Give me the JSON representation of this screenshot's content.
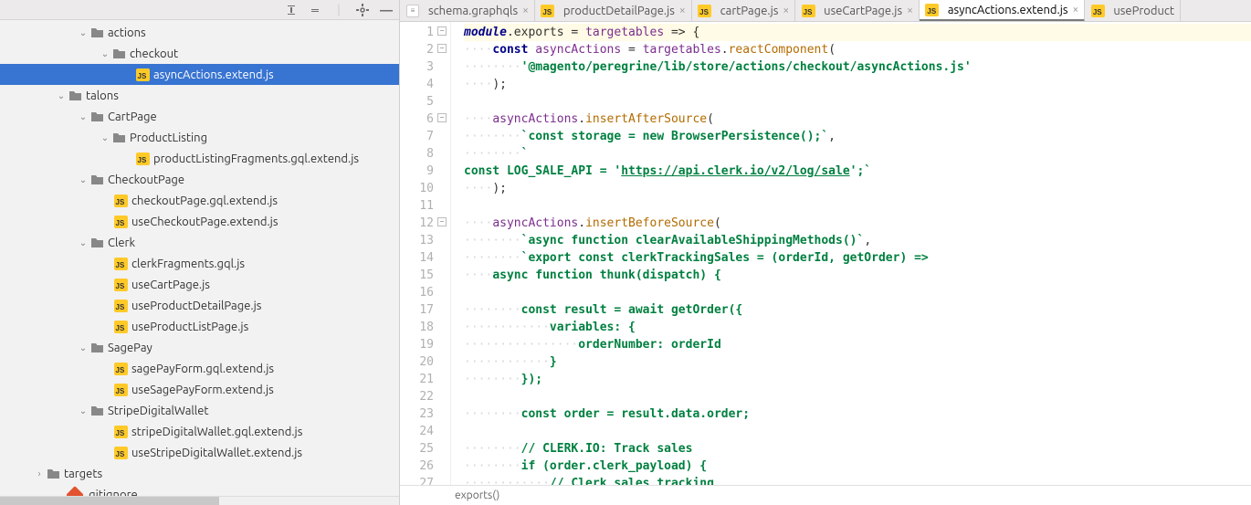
{
  "sidebar": {
    "tree": [
      {
        "indent": 84,
        "expander": "v",
        "icon": "folder",
        "label": "actions"
      },
      {
        "indent": 108,
        "expander": "v",
        "icon": "folder",
        "label": "checkout"
      },
      {
        "indent": 134,
        "expander": "",
        "icon": "js",
        "label": "asyncActions.extend.js",
        "selected": true
      },
      {
        "indent": 60,
        "expander": "v",
        "icon": "folder",
        "label": "talons"
      },
      {
        "indent": 84,
        "expander": "v",
        "icon": "folder",
        "label": "CartPage"
      },
      {
        "indent": 108,
        "expander": "v",
        "icon": "folder",
        "label": "ProductListing"
      },
      {
        "indent": 134,
        "expander": "",
        "icon": "js",
        "label": "productListingFragments.gql.extend.js"
      },
      {
        "indent": 84,
        "expander": "v",
        "icon": "folder",
        "label": "CheckoutPage"
      },
      {
        "indent": 110,
        "expander": "",
        "icon": "js",
        "label": "checkoutPage.gql.extend.js"
      },
      {
        "indent": 110,
        "expander": "",
        "icon": "js",
        "label": "useCheckoutPage.extend.js"
      },
      {
        "indent": 84,
        "expander": "v",
        "icon": "folder",
        "label": "Clerk"
      },
      {
        "indent": 110,
        "expander": "",
        "icon": "js",
        "label": "clerkFragments.gql.js"
      },
      {
        "indent": 110,
        "expander": "",
        "icon": "js",
        "label": "useCartPage.js"
      },
      {
        "indent": 110,
        "expander": "",
        "icon": "js",
        "label": "useProductDetailPage.js"
      },
      {
        "indent": 110,
        "expander": "",
        "icon": "js",
        "label": "useProductListPage.js"
      },
      {
        "indent": 84,
        "expander": "v",
        "icon": "folder",
        "label": "SagePay"
      },
      {
        "indent": 110,
        "expander": "",
        "icon": "js",
        "label": "sagePayForm.gql.extend.js"
      },
      {
        "indent": 110,
        "expander": "",
        "icon": "js",
        "label": "useSagePayForm.extend.js"
      },
      {
        "indent": 84,
        "expander": "v",
        "icon": "folder",
        "label": "StripeDigitalWallet"
      },
      {
        "indent": 110,
        "expander": "",
        "icon": "js",
        "label": "stripeDigitalWallet.gql.extend.js"
      },
      {
        "indent": 110,
        "expander": "",
        "icon": "js",
        "label": "useStripeDigitalWallet.extend.js"
      },
      {
        "indent": 36,
        "expander": ">",
        "icon": "folder",
        "label": "targets"
      },
      {
        "indent": 60,
        "expander": "",
        "icon": "git",
        "label": ".gitignore"
      }
    ]
  },
  "tabs": [
    {
      "icon": "gql",
      "label": "schema.graphqls"
    },
    {
      "icon": "js",
      "label": "productDetailPage.js"
    },
    {
      "icon": "js",
      "label": "cartPage.js"
    },
    {
      "icon": "js",
      "label": "useCartPage.js"
    },
    {
      "icon": "js",
      "label": "asyncActions.extend.js",
      "active": true
    },
    {
      "icon": "js",
      "label": "useProduct"
    }
  ],
  "code": {
    "lines": [
      {
        "n": 1,
        "fold": "-",
        "hl": true,
        "tokens": [
          {
            "t": "module",
            "c": "kw2"
          },
          {
            "t": ".exports = "
          },
          {
            "t": "targetables",
            "c": "def"
          },
          {
            "t": " => {"
          }
        ]
      },
      {
        "n": 2,
        "fold": "-",
        "tokens": [
          {
            "t": "    ",
            "d": 1
          },
          {
            "t": "const ",
            "c": "kw"
          },
          {
            "t": "asyncActions",
            "c": "def"
          },
          {
            "t": " = "
          },
          {
            "t": "targetables",
            "c": "def"
          },
          {
            "t": "."
          },
          {
            "t": "reactComponent",
            "c": "fn"
          },
          {
            "t": "("
          }
        ]
      },
      {
        "n": 3,
        "tokens": [
          {
            "t": "        ",
            "d": 1
          },
          {
            "t": "'@magento/peregrine/lib/store/actions/checkout/asyncActions.js'",
            "c": "str"
          }
        ]
      },
      {
        "n": 4,
        "tokens": [
          {
            "t": "    ",
            "d": 1
          },
          {
            "t": ");"
          }
        ]
      },
      {
        "n": 5,
        "tokens": [
          {
            "t": ""
          }
        ]
      },
      {
        "n": 6,
        "fold": "-",
        "tokens": [
          {
            "t": "    ",
            "d": 1
          },
          {
            "t": "asyncActions",
            "c": "def"
          },
          {
            "t": "."
          },
          {
            "t": "insertAfterSource",
            "c": "fn"
          },
          {
            "t": "("
          }
        ]
      },
      {
        "n": 7,
        "tokens": [
          {
            "t": "        ",
            "d": 1
          },
          {
            "t": "`const storage = new BrowserPersistence();`",
            "c": "str"
          },
          {
            "t": ","
          }
        ]
      },
      {
        "n": 8,
        "tokens": [
          {
            "t": "        ",
            "d": 1
          },
          {
            "t": "`",
            "c": "str"
          }
        ]
      },
      {
        "n": 9,
        "tokens": [
          {
            "t": "const LOG_SALE_API = '",
            "c": "str"
          },
          {
            "t": "https://api.clerk.io/v2/log/sale",
            "c": "str url"
          },
          {
            "t": "';`",
            "c": "str"
          }
        ]
      },
      {
        "n": 10,
        "tokens": [
          {
            "t": "    ",
            "d": 1
          },
          {
            "t": ");"
          }
        ]
      },
      {
        "n": 11,
        "tokens": [
          {
            "t": ""
          }
        ]
      },
      {
        "n": 12,
        "fold": "-",
        "tokens": [
          {
            "t": "    ",
            "d": 1
          },
          {
            "t": "asyncActions",
            "c": "def"
          },
          {
            "t": "."
          },
          {
            "t": "insertBeforeSource",
            "c": "fn"
          },
          {
            "t": "("
          }
        ]
      },
      {
        "n": 13,
        "tokens": [
          {
            "t": "        ",
            "d": 1
          },
          {
            "t": "`async function clearAvailableShippingMethods()`",
            "c": "str"
          },
          {
            "t": ","
          }
        ]
      },
      {
        "n": 14,
        "tokens": [
          {
            "t": "        ",
            "d": 1
          },
          {
            "t": "`export const clerkTrackingSales = (orderId, getOrder) =>",
            "c": "str"
          }
        ]
      },
      {
        "n": 15,
        "tokens": [
          {
            "t": "    ",
            "d": 1
          },
          {
            "t": "async function thunk(dispatch) {",
            "c": "str"
          }
        ]
      },
      {
        "n": 16,
        "tokens": [
          {
            "t": ""
          }
        ]
      },
      {
        "n": 17,
        "tokens": [
          {
            "t": "        ",
            "d": 1
          },
          {
            "t": "const result = await getOrder({",
            "c": "str"
          }
        ]
      },
      {
        "n": 18,
        "tokens": [
          {
            "t": "            ",
            "d": 1
          },
          {
            "t": "variables: {",
            "c": "str"
          }
        ]
      },
      {
        "n": 19,
        "tokens": [
          {
            "t": "                ",
            "d": 1
          },
          {
            "t": "orderNumber: orderId",
            "c": "str"
          }
        ]
      },
      {
        "n": 20,
        "tokens": [
          {
            "t": "            ",
            "d": 1
          },
          {
            "t": "}",
            "c": "str"
          }
        ]
      },
      {
        "n": 21,
        "tokens": [
          {
            "t": "        ",
            "d": 1
          },
          {
            "t": "});",
            "c": "str"
          }
        ]
      },
      {
        "n": 22,
        "tokens": [
          {
            "t": ""
          }
        ]
      },
      {
        "n": 23,
        "tokens": [
          {
            "t": "        ",
            "d": 1
          },
          {
            "t": "const order = result.data.order;",
            "c": "str"
          }
        ]
      },
      {
        "n": 24,
        "tokens": [
          {
            "t": ""
          }
        ]
      },
      {
        "n": 25,
        "tokens": [
          {
            "t": "        ",
            "d": 1
          },
          {
            "t": "// CLERK.IO: Track sales",
            "c": "str"
          }
        ]
      },
      {
        "n": 26,
        "tokens": [
          {
            "t": "        ",
            "d": 1
          },
          {
            "t": "if (order.clerk_payload) {",
            "c": "str"
          }
        ]
      },
      {
        "n": 27,
        "tokens": [
          {
            "t": "            ",
            "d": 1
          },
          {
            "t": "// Clerk sales tracking",
            "c": "str"
          }
        ]
      }
    ]
  },
  "breadcrumb": "exports()"
}
